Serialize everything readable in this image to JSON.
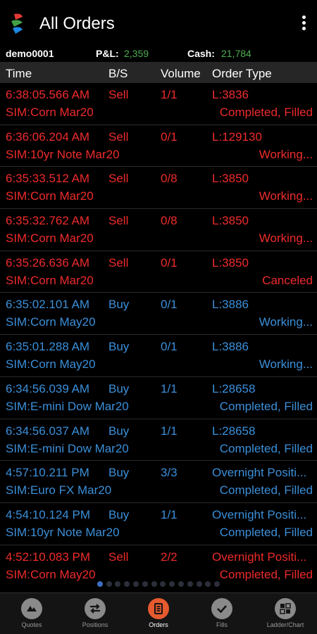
{
  "app": {
    "title": "All Orders"
  },
  "summary": {
    "account": "demo0001",
    "pnl_label": "P&L:",
    "pnl_value": "2,359",
    "cash_label": "Cash:",
    "cash_value": "21,784"
  },
  "columns": {
    "time": "Time",
    "side": "B/S",
    "volume": "Volume",
    "type": "Order Type"
  },
  "orders": [
    {
      "time": "6:38:05.566 AM",
      "side": "Sell",
      "volume": "1/1",
      "type": "L:3836",
      "instrument": "SIM:Corn Mar20",
      "status": "Completed, Filled"
    },
    {
      "time": "6:36:06.204 AM",
      "side": "Sell",
      "volume": "0/1",
      "type": "L:129130",
      "instrument": "SIM:10yr Note Mar20",
      "status": "Working..."
    },
    {
      "time": "6:35:33.512 AM",
      "side": "Sell",
      "volume": "0/8",
      "type": "L:3850",
      "instrument": "SIM:Corn Mar20",
      "status": "Working..."
    },
    {
      "time": "6:35:32.762 AM",
      "side": "Sell",
      "volume": "0/8",
      "type": "L:3850",
      "instrument": "SIM:Corn Mar20",
      "status": "Working..."
    },
    {
      "time": "6:35:26.636 AM",
      "side": "Sell",
      "volume": "0/1",
      "type": "L:3850",
      "instrument": "SIM:Corn Mar20",
      "status": "Canceled"
    },
    {
      "time": "6:35:02.101 AM",
      "side": "Buy",
      "volume": "0/1",
      "type": "L:3886",
      "instrument": "SIM:Corn May20",
      "status": "Working..."
    },
    {
      "time": "6:35:01.288 AM",
      "side": "Buy",
      "volume": "0/1",
      "type": "L:3886",
      "instrument": "SIM:Corn May20",
      "status": "Working..."
    },
    {
      "time": "6:34:56.039 AM",
      "side": "Buy",
      "volume": "1/1",
      "type": "L:28658",
      "instrument": "SIM:E-mini Dow Mar20",
      "status": "Completed, Filled"
    },
    {
      "time": "6:34:56.037 AM",
      "side": "Buy",
      "volume": "1/1",
      "type": "L:28658",
      "instrument": "SIM:E-mini Dow Mar20",
      "status": "Completed, Filled"
    },
    {
      "time": "4:57:10.211 PM",
      "side": "Buy",
      "volume": "3/3",
      "type": "Overnight Positi...",
      "instrument": "SIM:Euro FX Mar20",
      "status": "Completed, Filled"
    },
    {
      "time": "4:54:10.124 PM",
      "side": "Buy",
      "volume": "1/1",
      "type": "Overnight Positi...",
      "instrument": "SIM:10yr Note Mar20",
      "status": "Completed, Filled"
    },
    {
      "time": "4:52:10.083 PM",
      "side": "Sell",
      "volume": "2/2",
      "type": "Overnight Positi...",
      "instrument": "SIM:Corn May20",
      "status": "Completed, Filled"
    }
  ],
  "pager": {
    "count": 14,
    "active": 0
  },
  "tabs": [
    {
      "label": "Quotes",
      "icon": "quotes-icon",
      "active": false
    },
    {
      "label": "Positions",
      "icon": "positions-icon",
      "active": false
    },
    {
      "label": "Orders",
      "icon": "orders-icon",
      "active": true
    },
    {
      "label": "Fills",
      "icon": "fills-icon",
      "active": false
    },
    {
      "label": "Ladder/Chart",
      "icon": "ladder-chart-icon",
      "active": false
    }
  ],
  "colors": {
    "sell": "#ef2b2b",
    "buy": "#3b8fd9",
    "positive": "#4caf50",
    "active_tab": "#e65a2f"
  }
}
